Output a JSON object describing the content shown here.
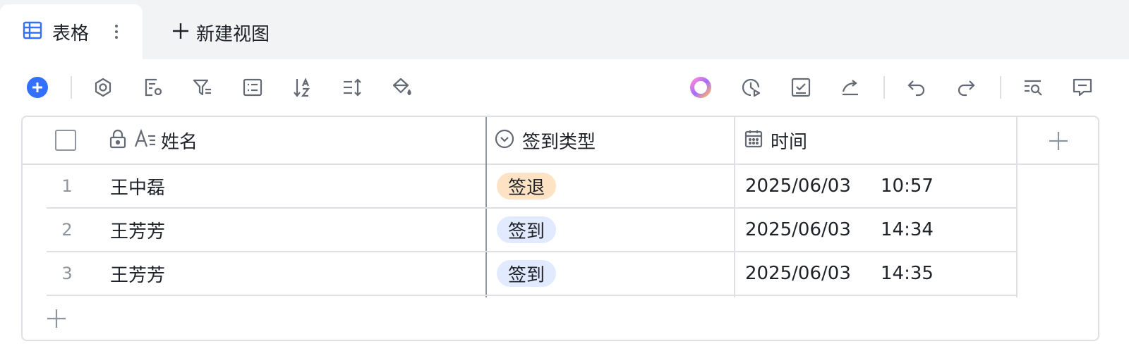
{
  "tabs": {
    "active": {
      "label": "表格",
      "icon": "grid-table-icon"
    },
    "new_view": {
      "label": "新建视图",
      "icon": "plus-icon"
    }
  },
  "toolbar": {
    "left_icons": [
      "add-record-icon",
      "settings-icon",
      "field-config-icon",
      "filter-icon",
      "group-icon",
      "sort-icon",
      "row-height-icon",
      "fill-color-icon"
    ],
    "right_icons": [
      "ai-assistant-icon",
      "history-icon",
      "check-task-icon",
      "share-icon",
      "undo-icon",
      "redo-icon",
      "search-icon",
      "comment-icon"
    ],
    "accent_color": "#3370ff"
  },
  "table": {
    "columns": [
      {
        "label": "姓名",
        "icon": "text-field-icon",
        "locked": true
      },
      {
        "label": "签到类型",
        "icon": "single-select-icon"
      },
      {
        "label": "时间",
        "icon": "calendar-icon"
      }
    ],
    "rows": [
      {
        "num": "1",
        "name": "王中磊",
        "type": "签退",
        "type_color": "orange",
        "date": "2025/06/03",
        "time": "10:57"
      },
      {
        "num": "2",
        "name": "王芳芳",
        "type": "签到",
        "type_color": "blue",
        "date": "2025/06/03",
        "time": "14:34"
      },
      {
        "num": "3",
        "name": "王芳芳",
        "type": "签到",
        "type_color": "blue",
        "date": "2025/06/03",
        "time": "14:35"
      }
    ]
  },
  "colors": {
    "tag_orange": "#fde2c4",
    "tag_blue": "#e1eaff",
    "border": "#dee0e3"
  }
}
